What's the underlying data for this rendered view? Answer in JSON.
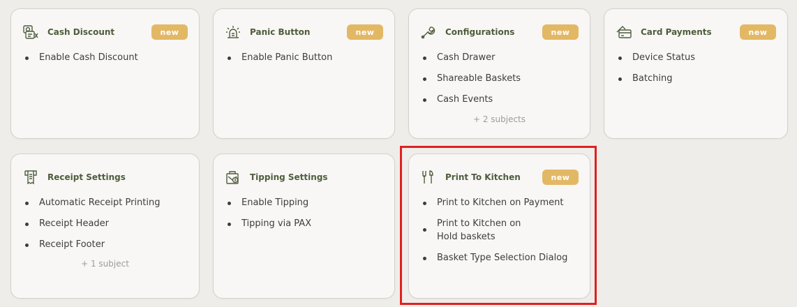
{
  "colors": {
    "background": "#efedea",
    "card": "#f8f7f5",
    "title": "#4e5d3c",
    "badge": "#e3b865",
    "highlight": "#e0201f"
  },
  "cards": [
    {
      "title": "Cash Discount",
      "icon": "cash-discount-icon",
      "badge": "new",
      "items": [
        "Enable Cash Discount"
      ]
    },
    {
      "title": "Panic Button",
      "icon": "panic-button-icon",
      "badge": "new",
      "items": [
        "Enable Panic Button"
      ]
    },
    {
      "title": "Configurations",
      "icon": "wrench-icon",
      "badge": "new",
      "items": [
        "Cash Drawer",
        "Shareable Baskets",
        "Cash Events"
      ],
      "more": "+ 2 subjects"
    },
    {
      "title": "Card Payments",
      "icon": "card-payment-icon",
      "badge": "new",
      "items": [
        "Device Status",
        "Batching"
      ]
    },
    {
      "title": "Receipt Settings",
      "icon": "receipt-icon",
      "items": [
        "Automatic Receipt Printing",
        "Receipt Header",
        "Receipt Footer"
      ],
      "more": "+ 1 subject"
    },
    {
      "title": "Tipping Settings",
      "icon": "tipping-icon",
      "items": [
        "Enable Tipping",
        "Tipping via PAX"
      ]
    },
    {
      "title": "Print To Kitchen",
      "icon": "kitchen-utensils-icon",
      "badge": "new",
      "items": [
        "Print to Kitchen on Payment",
        "Print to Kitchen on Hold baskets",
        "Basket Type Selection Dialog"
      ]
    }
  ]
}
